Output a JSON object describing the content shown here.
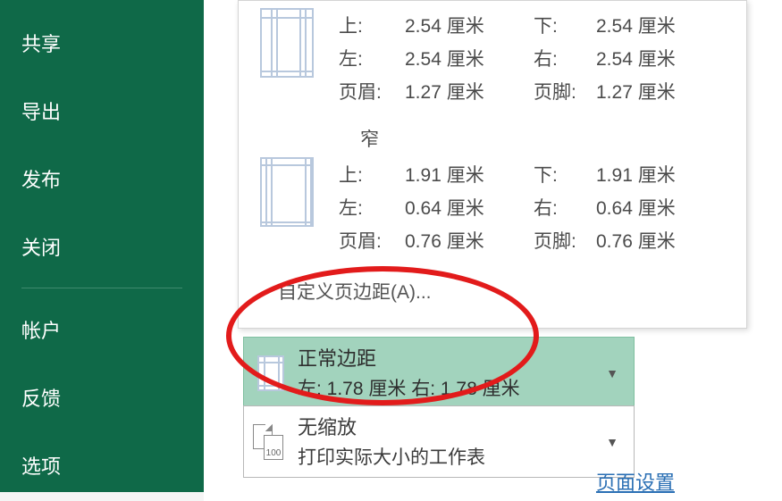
{
  "sidebar": {
    "items": [
      {
        "label": "共享"
      },
      {
        "label": "导出"
      },
      {
        "label": "发布"
      },
      {
        "label": "关闭"
      },
      {
        "label": "帐户"
      },
      {
        "label": "反馈"
      },
      {
        "label": "选项"
      }
    ]
  },
  "presets": {
    "wide": {
      "top_lbl": "上:",
      "top_val": "2.54 厘米",
      "bottom_lbl": "下:",
      "bottom_val": "2.54 厘米",
      "left_lbl": "左:",
      "left_val": "2.54 厘米",
      "right_lbl": "右:",
      "right_val": "2.54 厘米",
      "header_lbl": "页眉:",
      "header_val": "1.27 厘米",
      "footer_lbl": "页脚:",
      "footer_val": "1.27 厘米"
    },
    "narrow": {
      "title": "窄",
      "top_lbl": "上:",
      "top_val": "1.91 厘米",
      "bottom_lbl": "下:",
      "bottom_val": "1.91 厘米",
      "left_lbl": "左:",
      "left_val": "0.64 厘米",
      "right_lbl": "右:",
      "right_val": "0.64 厘米",
      "header_lbl": "页眉:",
      "header_val": "0.76 厘米",
      "footer_lbl": "页脚:",
      "footer_val": "0.76 厘米"
    }
  },
  "custom_margins": "自定义页边距(A)...",
  "selector_margin": {
    "title": "正常边距",
    "sub": "左: 1.78 厘米   右: 1.78 厘米"
  },
  "selector_scale": {
    "title": "无缩放",
    "sub": "打印实际大小的工作表",
    "badge": "100"
  },
  "page_setup": "页面设置"
}
